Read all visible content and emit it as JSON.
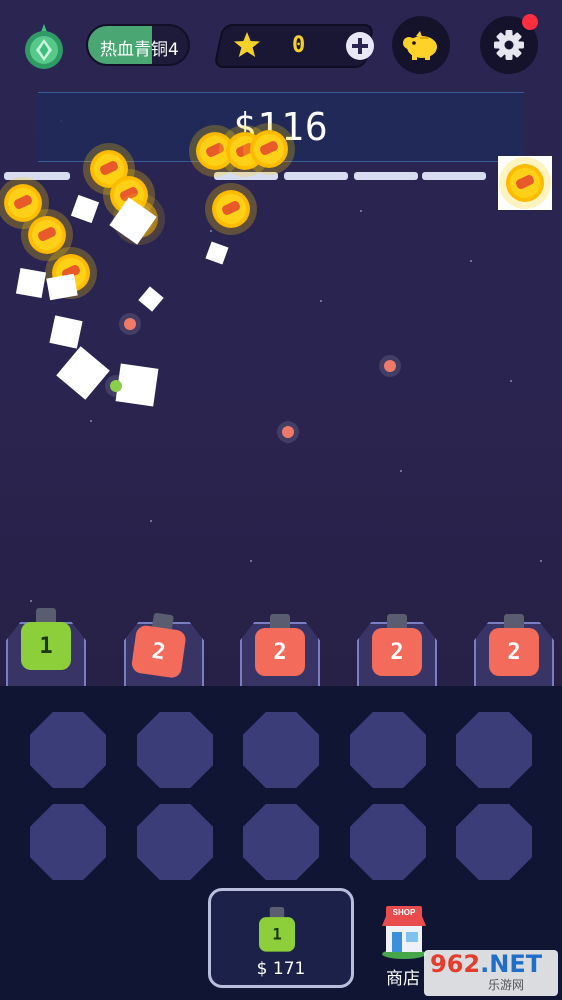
{
  "hud": {
    "rank_label": "热血青铜4",
    "star_count": "0",
    "icons": [
      "rank-gem-icon",
      "star-icon",
      "plus-icon",
      "piggy-bank-icon",
      "gear-icon"
    ],
    "notification_color": "#ff2e3e"
  },
  "money": {
    "amount": "$116"
  },
  "cannons": [
    {
      "level": "1",
      "color": "#8dcf3a"
    },
    {
      "level": "2",
      "color": "#f26b5b"
    },
    {
      "level": "2",
      "color": "#f26b5b"
    },
    {
      "level": "2",
      "color": "#f26b5b"
    },
    {
      "level": "2",
      "color": "#f26b5b"
    }
  ],
  "shop_panel": {
    "buy_level": "1",
    "buy_price": "$ 171",
    "shop_label": "商店"
  },
  "watermark": {
    "brand_main": "962",
    "brand_suffix": ".NET",
    "sub": "乐游网"
  }
}
